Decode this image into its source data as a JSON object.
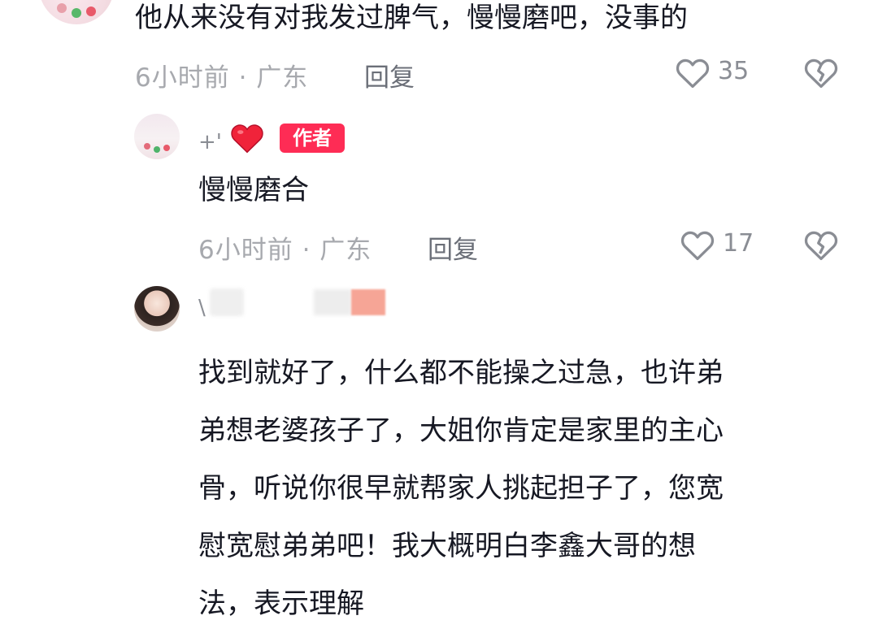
{
  "comment1": {
    "text": "他从来没有对我发过脾气，慢慢磨吧，没事的",
    "meta": "6小时前 · 广东",
    "reply_label": "回复",
    "likes": "35",
    "like_icon": "heart-outline-icon",
    "dislike_icon": "broken-heart-icon"
  },
  "reply1": {
    "username": "+'",
    "badge": "作者",
    "text": "慢慢磨合",
    "meta": "6小时前 · 广东",
    "reply_label": "回复",
    "likes": "17",
    "emoji_color": "#f0233a"
  },
  "reply2": {
    "username": "\\",
    "lines": [
      "找到就好了，什么都不能操之过急，也许弟",
      "弟想老婆孩子了，大姐你肯定是家里的主心",
      "骨，听说你很早就帮家人挑起担子了，您宽",
      "慰宽慰弟弟吧！我大概明白李鑫大哥的想",
      "法，表示理解"
    ]
  },
  "colors": {
    "accent": "#fe2c55",
    "meta": "#a7a9ae",
    "text": "#161823"
  }
}
